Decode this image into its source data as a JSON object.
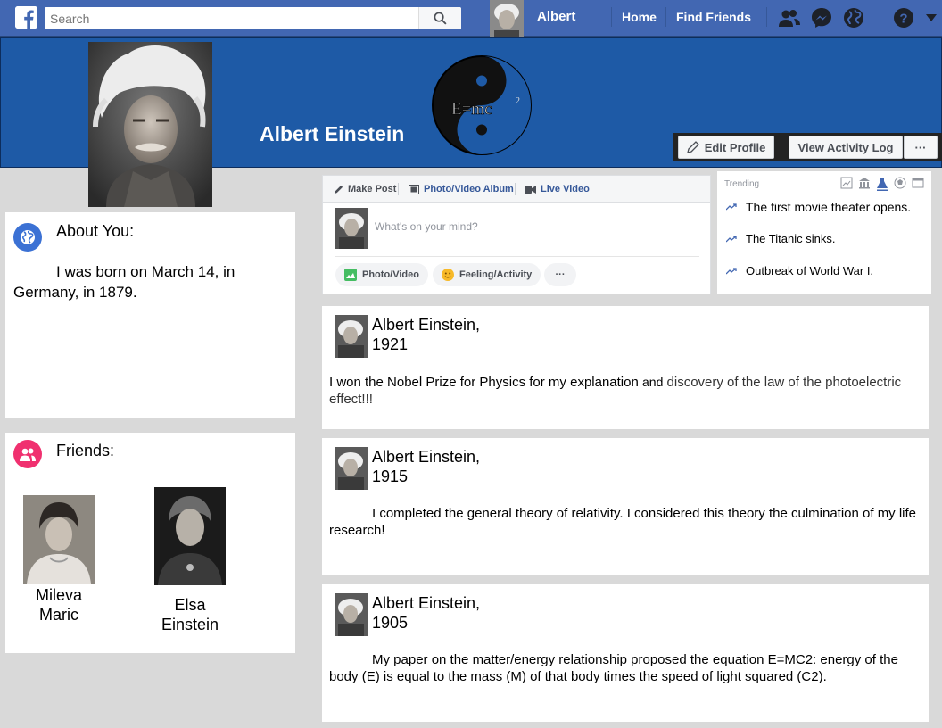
{
  "topbar": {
    "search_placeholder": "Search",
    "user_name": "Albert",
    "home": "Home",
    "find_friends": "Find Friends",
    "brand_color": "#4267b2"
  },
  "cover": {
    "name": "Albert Einstein",
    "emblem_text": "E=mc",
    "emblem_sup": "2",
    "edit_profile": "Edit Profile",
    "view_activity_log": "View Activity Log",
    "more": "···"
  },
  "about": {
    "title": "About You:",
    "text": "I was born on March 14, in Germany, in 1879."
  },
  "friends": {
    "title": "Friends:",
    "list": [
      {
        "name": "Mileva Maric"
      },
      {
        "name": "Elsa Einstein"
      }
    ]
  },
  "composer": {
    "tab_make_post": "Make Post",
    "tab_album": "Photo/Video Album",
    "tab_live": "Live Video",
    "placeholder": "What's on your mind?",
    "photo_video": "Photo/Video",
    "feeling": "Feeling/Activity",
    "more": "···"
  },
  "trending": {
    "label": "Trending",
    "items": [
      "The first movie theater opens.",
      "The Titanic sinks.",
      "Outbreak of World War I."
    ]
  },
  "posts": [
    {
      "author": "Albert Einstein,",
      "year": "1921",
      "text_a": "I won the Nobel Prize for Physics for my explanation",
      "text_b": "and",
      "text_c": "discovery of the law of the photoelectric effect!!!"
    },
    {
      "author": "Albert Einstein,",
      "year": "1915",
      "text": "I completed the general theory of relativity. I considered this theory the culmination of my life research!"
    },
    {
      "author": "Albert Einstein,",
      "year": "1905",
      "text": "My paper on the matter/energy relationship proposed the equation E=MC2: energy of the body (E) is equal to the mass (M) of that body times the speed of light squared (C2)."
    }
  ]
}
